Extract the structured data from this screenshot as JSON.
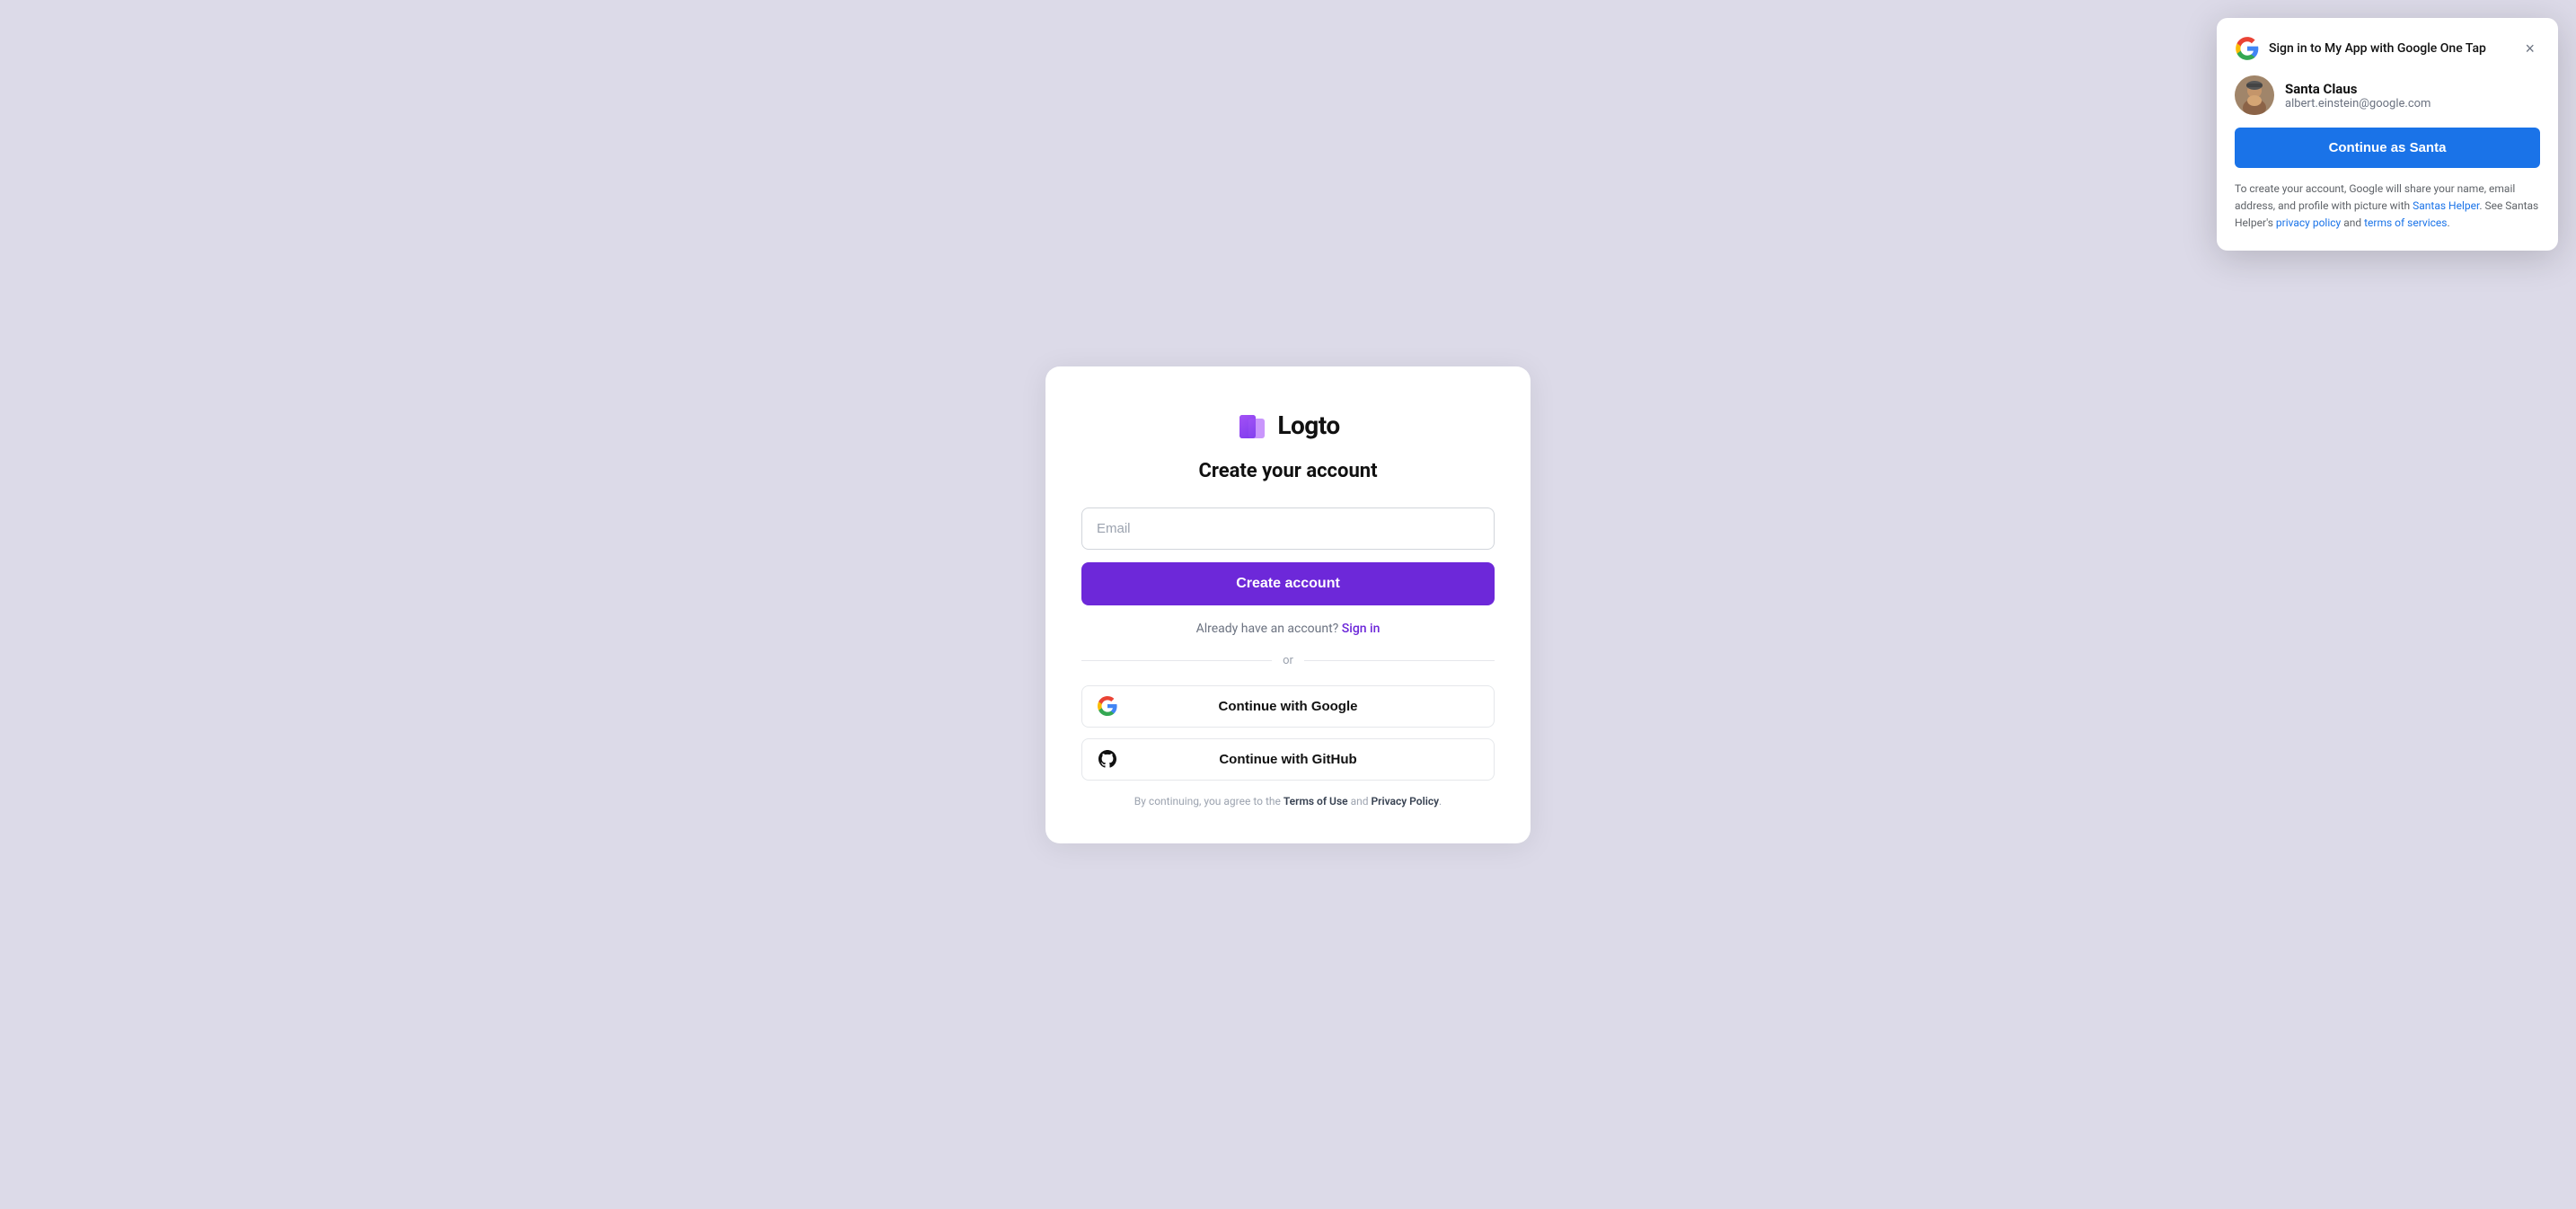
{
  "page": {
    "background_color": "#dcdae8"
  },
  "logo": {
    "text": "Logto"
  },
  "main_card": {
    "title": "Create your account",
    "email_placeholder": "Email",
    "create_account_btn": "Create account",
    "signin_prompt": "Already have an account?",
    "signin_link": "Sign in",
    "divider_text": "or",
    "google_btn": "Continue with Google",
    "github_btn": "Continue with GitHub",
    "footer_text": "By continuing, you agree to the",
    "footer_terms": "Terms of Use",
    "footer_and": "and",
    "footer_privacy": "Privacy Policy",
    "footer_period": "."
  },
  "one_tap": {
    "title": "Sign in to My App with Google One Tap",
    "close_label": "×",
    "user_name": "Santa Claus",
    "user_email": "albert.einstein@google.com",
    "continue_btn": "Continue as Santa",
    "footer_prefix": "To create your account, Google will share your name, email address, and profile with picture with",
    "footer_app_link": "Santas Helper",
    "footer_middle": ". See Santas Helper's",
    "footer_privacy_link": "privacy policy",
    "footer_and": "and",
    "footer_terms_link": "terms of services",
    "footer_suffix": "."
  }
}
